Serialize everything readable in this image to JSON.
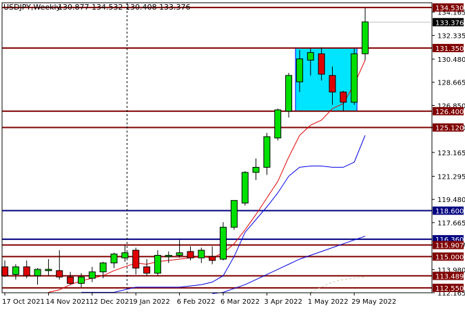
{
  "header": {
    "symbol_text": "USDJPY,Weekly",
    "ohlc_text": "130.877 134.532 130.408 133.376"
  },
  "chart_data": {
    "type": "candlestick",
    "symbol": "USDJPY",
    "timeframe": "Weekly",
    "ohlc_header": {
      "open": 130.877,
      "high": 134.532,
      "low": 130.408,
      "close": 133.376
    },
    "ylim": [
      112.165,
      134.9
    ],
    "y_tick_labels": [
      "134.165",
      "132.335",
      "130.480",
      "128.665",
      "126.850",
      "125.120",
      "123.165",
      "121.295",
      "119.480",
      "117.665",
      "115.907",
      "113.980",
      "112.165"
    ],
    "x_tick_labels": [
      "17 Oct 2021",
      "14 Nov 2021",
      "12 Dec 2021",
      "9 Jan 2022",
      "6 Feb 2022",
      "6 Mar 2022",
      "3 Apr 2022",
      "1 May 2022",
      "29 May 2022"
    ],
    "candles": [
      {
        "o": 114.2,
        "h": 114.7,
        "l": 113.4,
        "c": 113.5
      },
      {
        "o": 113.6,
        "h": 114.4,
        "l": 113.2,
        "c": 114.2
      },
      {
        "o": 114.2,
        "h": 114.7,
        "l": 113.3,
        "c": 113.5
      },
      {
        "o": 113.5,
        "h": 114.1,
        "l": 112.8,
        "c": 114.0
      },
      {
        "o": 113.9,
        "h": 114.8,
        "l": 113.5,
        "c": 114.0
      },
      {
        "o": 113.9,
        "h": 115.5,
        "l": 113.2,
        "c": 113.4
      },
      {
        "o": 113.4,
        "h": 113.8,
        "l": 112.8,
        "c": 112.9
      },
      {
        "o": 112.9,
        "h": 113.7,
        "l": 112.6,
        "c": 113.4
      },
      {
        "o": 113.3,
        "h": 114.2,
        "l": 113.0,
        "c": 113.8
      },
      {
        "o": 113.8,
        "h": 114.6,
        "l": 113.3,
        "c": 114.5
      },
      {
        "o": 114.5,
        "h": 115.3,
        "l": 114.1,
        "c": 115.2
      },
      {
        "o": 114.9,
        "h": 115.9,
        "l": 114.6,
        "c": 115.3
      },
      {
        "o": 115.5,
        "h": 115.7,
        "l": 113.6,
        "c": 114.1
      },
      {
        "o": 114.2,
        "h": 114.8,
        "l": 113.5,
        "c": 113.7
      },
      {
        "o": 113.7,
        "h": 115.5,
        "l": 113.5,
        "c": 115.1
      },
      {
        "o": 115.0,
        "h": 115.4,
        "l": 114.5,
        "c": 115.1
      },
      {
        "o": 115.1,
        "h": 116.3,
        "l": 114.9,
        "c": 115.3
      },
      {
        "o": 115.4,
        "h": 115.8,
        "l": 114.7,
        "c": 114.9
      },
      {
        "o": 114.9,
        "h": 115.7,
        "l": 114.5,
        "c": 115.5
      },
      {
        "o": 115.0,
        "h": 115.8,
        "l": 114.4,
        "c": 114.7
      },
      {
        "o": 114.8,
        "h": 117.7,
        "l": 114.7,
        "c": 117.3
      },
      {
        "o": 117.3,
        "h": 119.4,
        "l": 117.1,
        "c": 119.4
      },
      {
        "o": 119.2,
        "h": 121.7,
        "l": 119.0,
        "c": 121.6
      },
      {
        "o": 121.6,
        "h": 122.7,
        "l": 121.0,
        "c": 122.0
      },
      {
        "o": 122.0,
        "h": 124.7,
        "l": 121.4,
        "c": 124.4
      },
      {
        "o": 124.3,
        "h": 126.6,
        "l": 124.1,
        "c": 126.5
      },
      {
        "o": 126.4,
        "h": 129.4,
        "l": 125.9,
        "c": 129.2
      },
      {
        "o": 128.7,
        "h": 131.2,
        "l": 127.9,
        "c": 130.5
      },
      {
        "o": 130.4,
        "h": 131.3,
        "l": 129.2,
        "c": 131.0
      },
      {
        "o": 130.9,
        "h": 131.4,
        "l": 128.8,
        "c": 129.3
      },
      {
        "o": 129.2,
        "h": 129.9,
        "l": 126.9,
        "c": 127.9
      },
      {
        "o": 127.9,
        "h": 128.0,
        "l": 126.4,
        "c": 127.1
      },
      {
        "o": 127.1,
        "h": 131.3,
        "l": 126.9,
        "c": 130.9
      },
      {
        "o": 130.9,
        "h": 134.5,
        "l": 130.4,
        "c": 133.4
      }
    ],
    "series": [
      {
        "type": "line",
        "color": "#e00000",
        "values": [
          null,
          null,
          null,
          null,
          112.2,
          112.4,
          112.8,
          113.1,
          113.3,
          113.5,
          113.9,
          114.2,
          114.5,
          114.4,
          114.6,
          114.7,
          114.8,
          114.9,
          115.0,
          114.9,
          115.3,
          116.0,
          117.1,
          118.3,
          119.6,
          120.9,
          122.8,
          124.5,
          125.3,
          125.7,
          126.6,
          127.0,
          128.5,
          130.4
        ]
      },
      {
        "type": "line",
        "color": "#0000e0",
        "values": [
          null,
          null,
          null,
          null,
          null,
          null,
          null,
          112.2,
          112.2,
          112.2,
          112.2,
          112.4,
          112.6,
          112.6,
          112.6,
          112.6,
          112.6,
          112.7,
          112.8,
          113.0,
          113.5,
          115.0,
          116.9,
          117.9,
          118.9,
          120.0,
          121.3,
          122.0,
          122.1,
          122.1,
          122.0,
          122.0,
          122.4,
          124.5
        ]
      },
      {
        "type": "line",
        "color": "#0000e0",
        "values": [
          null,
          null,
          null,
          null,
          null,
          null,
          null,
          null,
          null,
          null,
          null,
          null,
          null,
          null,
          null,
          null,
          null,
          null,
          null,
          112.1,
          112.2,
          112.5,
          112.8,
          113.2,
          113.6,
          114.0,
          114.4,
          114.8,
          115.1,
          115.4,
          115.7,
          116.0,
          116.3,
          116.6
        ]
      },
      {
        "type": "line",
        "color": "#c8c8a0",
        "dash": true,
        "values": [
          null,
          null,
          null,
          null,
          null,
          null,
          null,
          null,
          null,
          null,
          null,
          null,
          null,
          null,
          null,
          null,
          null,
          null,
          null,
          null,
          null,
          null,
          null,
          null,
          null,
          null,
          null,
          null,
          112.2,
          112.6,
          113.0,
          113.2,
          113.3,
          113.4
        ]
      }
    ],
    "horizontal_levels": [
      {
        "value": 134.53,
        "label": "134.530",
        "color": "#800000",
        "tag_color": "#800000"
      },
      {
        "value": 131.35,
        "label": "131.350",
        "color": "#800000",
        "tag_color": "#800000"
      },
      {
        "value": 126.4,
        "label": "126.400",
        "color": "#800000",
        "tag_color": "#800000"
      },
      {
        "value": 125.12,
        "label": "125.120",
        "color": "#800000",
        "tag_color": "#800000"
      },
      {
        "value": 118.6,
        "label": "118.600",
        "color": "#000080",
        "tag_color": "#000080"
      },
      {
        "value": 116.36,
        "label": "116.360",
        "color": "#000080",
        "tag_color": "#000080"
      },
      {
        "value": 115.907,
        "label": "115.907",
        "color": "#800000",
        "tag_color": "#800000"
      },
      {
        "value": 115.0,
        "label": "115.000",
        "color": "#800000",
        "tag_color": "#800000"
      },
      {
        "value": 113.489,
        "label": "113.489",
        "color": "#800000",
        "tag_color": "#800000"
      },
      {
        "value": 112.55,
        "label": "112.550",
        "color": "#800000",
        "tag_color": "#800000"
      }
    ],
    "current_price_label": "133.376",
    "rectangle": {
      "from_index": 27,
      "to_index": 32,
      "top": 131.35,
      "bottom": 126.4,
      "color": "#00e5ff"
    },
    "vertical_marker_index": 11,
    "colors": {
      "bull": "#00e000",
      "bear": "#e00000",
      "outline": "#000000",
      "background": "#ffffff"
    }
  }
}
